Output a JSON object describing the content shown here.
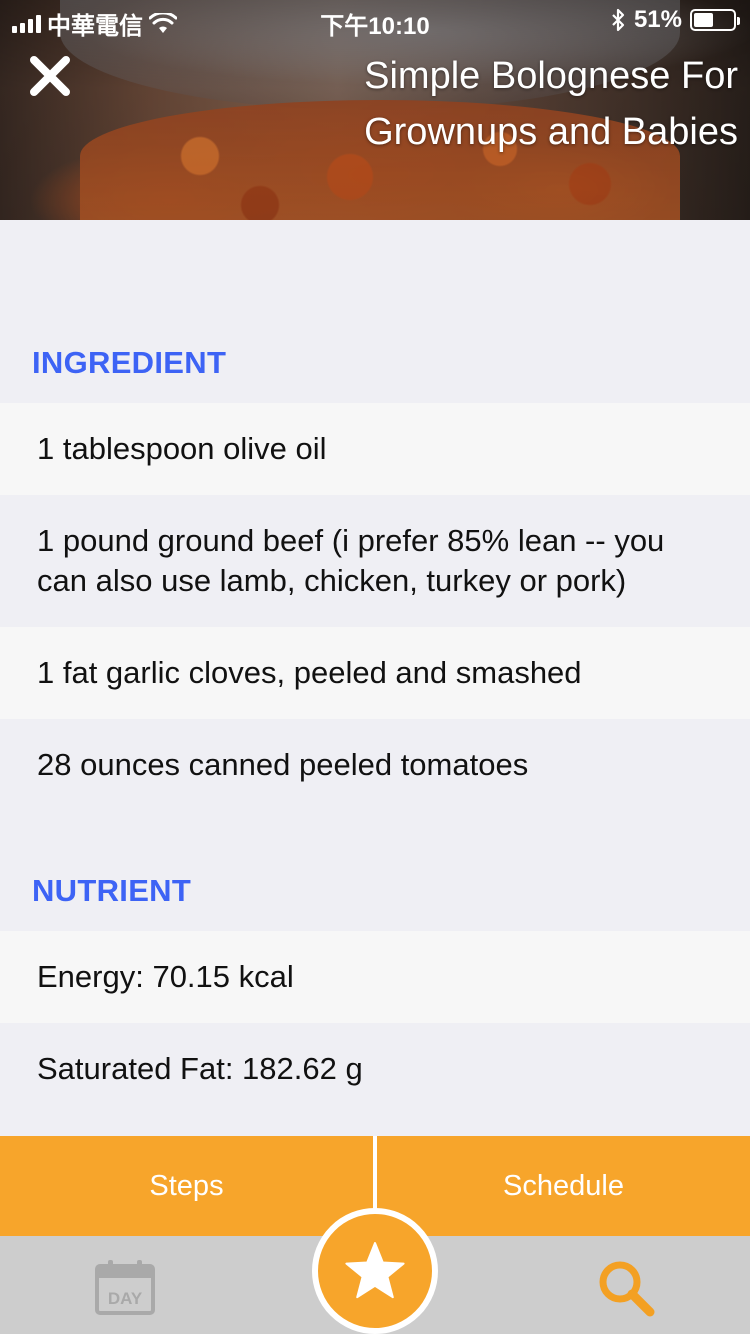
{
  "status_bar": {
    "carrier": "中華電信",
    "time": "下午10:10",
    "battery_percent": "51%",
    "battery_level": 0.51
  },
  "header": {
    "title": "Simple Bolognese For Grownups and Babies",
    "close_icon": "close-icon"
  },
  "ingredients": {
    "heading": "INGREDIENT",
    "items": [
      "1 tablespoon olive oil",
      "1 pound ground beef (i prefer 85% lean -- you can also use lamb, chicken, turkey or pork)",
      "1 fat garlic cloves, peeled and smashed",
      "28 ounces canned peeled tomatoes"
    ]
  },
  "nutrients": {
    "heading": "NUTRIENT",
    "items": [
      "Energy: 70.15 kcal",
      "Saturated Fat: 182.62 g"
    ]
  },
  "actions": {
    "steps_label": "Steps",
    "schedule_label": "Schedule"
  },
  "tab_bar": {
    "day_label": "DAY",
    "day_icon": "calendar-day-icon",
    "favorite_icon": "star-icon",
    "search_icon": "search-icon"
  },
  "colors": {
    "accent_blue": "#3d63f5",
    "accent_orange": "#f7a52b",
    "tab_bar_bg": "#cdcdcd",
    "search_orange": "#f3a023"
  }
}
